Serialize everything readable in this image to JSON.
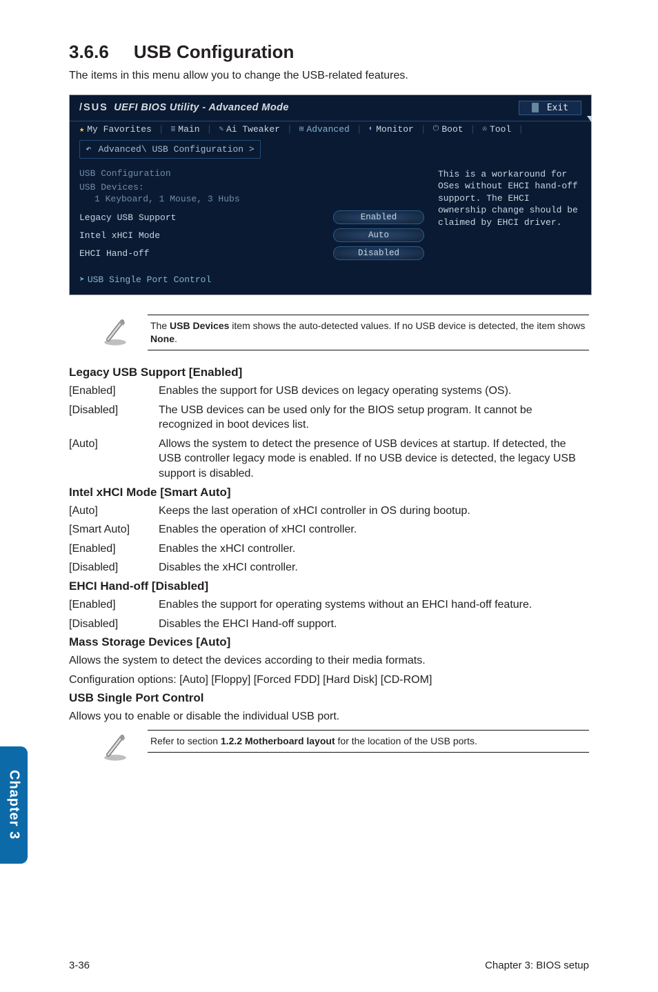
{
  "heading": {
    "number": "3.6.6",
    "title": "USB Configuration"
  },
  "intro": "The items in this menu allow you to change the USB-related features.",
  "bios": {
    "title_prefix": "/SUS",
    "title_rest": "UEFI BIOS Utility - Advanced Mode",
    "exit": "Exit",
    "menu": {
      "fav": "My Favorites",
      "main": "Main",
      "ai": "Ai Tweaker",
      "adv": "Advanced",
      "mon": "Monitor",
      "boot": "Boot",
      "tool": "Tool"
    },
    "crumb": "Advanced\\ USB Configuration >",
    "rows": {
      "cfg": "USB Configuration",
      "dev": "USB Devices:",
      "dev_sub": "1 Keyboard, 1 Mouse, 3 Hubs",
      "legacy": {
        "label": "Legacy USB Support",
        "value": "Enabled"
      },
      "xhci": {
        "label": "Intel xHCI Mode",
        "value": "Auto"
      },
      "ehci": {
        "label": "EHCI Hand-off",
        "value": "Disabled"
      },
      "spc": "USB Single Port Control"
    },
    "help": "This is a workaround for OSes without EHCI hand-off support. The EHCI ownership change should be claimed by EHCI driver."
  },
  "note1": {
    "pre": "The ",
    "bold1": "USB Devices",
    "mid": " item shows the auto-detected values. If no USB device is detected, the item shows ",
    "bold2": "None",
    "post": "."
  },
  "legacy": {
    "head": "Legacy USB Support [Enabled]",
    "r1k": "[Enabled]",
    "r1v": "Enables the support for USB devices on legacy operating systems (OS).",
    "r2k": "[Disabled]",
    "r2v": "The USB devices can be used only for the BIOS setup program. It cannot be recognized in boot devices list.",
    "r3k": "[Auto]",
    "r3v": "Allows the system to detect the presence of USB devices at startup. If detected, the USB controller legacy mode is enabled. If no USB device is detected, the legacy USB support is disabled."
  },
  "xhci": {
    "head": "Intel xHCI Mode [Smart Auto]",
    "r1k": "[Auto]",
    "r1v": "Keeps the last operation of xHCI controller in OS during bootup.",
    "r2k": "[Smart Auto]",
    "r2v": "Enables the operation of xHCI controller.",
    "r3k": "[Enabled]",
    "r3v": "Enables the xHCI controller.",
    "r4k": "[Disabled]",
    "r4v": "Disables the xHCI controller."
  },
  "ehci": {
    "head": "EHCI Hand-off [Disabled]",
    "r1k": "[Enabled]",
    "r1v": "Enables the support for operating systems without an EHCI hand-off feature.",
    "r2k": "[Disabled]",
    "r2v": "Disables the EHCI Hand-off support."
  },
  "mass": {
    "head": "Mass Storage Devices [Auto]",
    "l1": "Allows the system to detect the devices according to their media formats.",
    "l2": "Configuration options: [Auto] [Floppy] [Forced FDD] [Hard Disk] [CD-ROM]"
  },
  "single": {
    "head": "USB Single Port Control",
    "l1": "Allows you to enable or disable the individual USB port."
  },
  "note2": {
    "pre": "Refer to section ",
    "bold": "1.2.2 Motherboard layout",
    "post": " for the location of the USB ports."
  },
  "tab": "Chapter 3",
  "footer": {
    "left": "3-36",
    "right": "Chapter 3: BIOS setup"
  }
}
